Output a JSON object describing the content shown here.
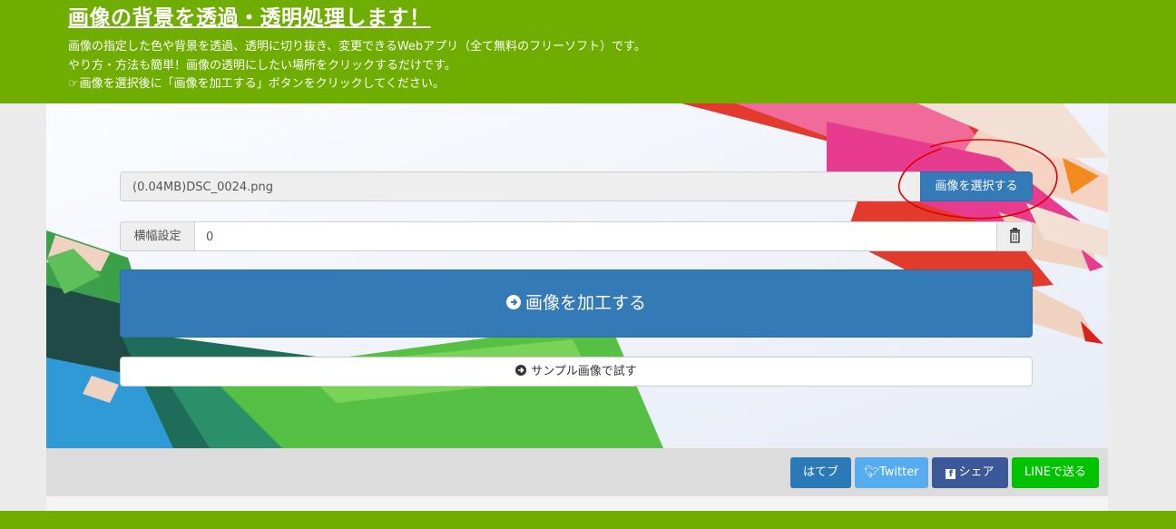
{
  "header": {
    "title": "画像の背景を透過・透明処理します！",
    "desc_line1": "画像の指定した色や背景を透過、透明に切り抜き、変更できるWebアプリ（全て無料のフリーソフト）です。",
    "desc_line2": "やり方・方法も簡単！画像の透明にしたい場所をクリックするだけです。",
    "desc_line3": "画像を選択後に「画像を加工する」ボタンをクリックしてください。",
    "hand_icon": "hand-point-right-icon"
  },
  "file_input": {
    "filename": "(0.04MB)DSC_0024.png",
    "select_label": "画像を選択する"
  },
  "width_setting": {
    "label": "横幅設定",
    "value": "0",
    "trash_icon": "trash-icon"
  },
  "actions": {
    "process_label": "画像を加工する",
    "sample_label": "サンプル画像で試す"
  },
  "share": {
    "hatena": "はてブ",
    "twitter": "Twitter",
    "facebook": "シェア",
    "line": "LINEで送る"
  },
  "colors": {
    "header_green": "#6fad00",
    "primary_blue": "#337ab7",
    "twitter_blue": "#55acee",
    "facebook_blue": "#3b5998",
    "line_green": "#00c300",
    "annotation_red": "#e00000"
  }
}
